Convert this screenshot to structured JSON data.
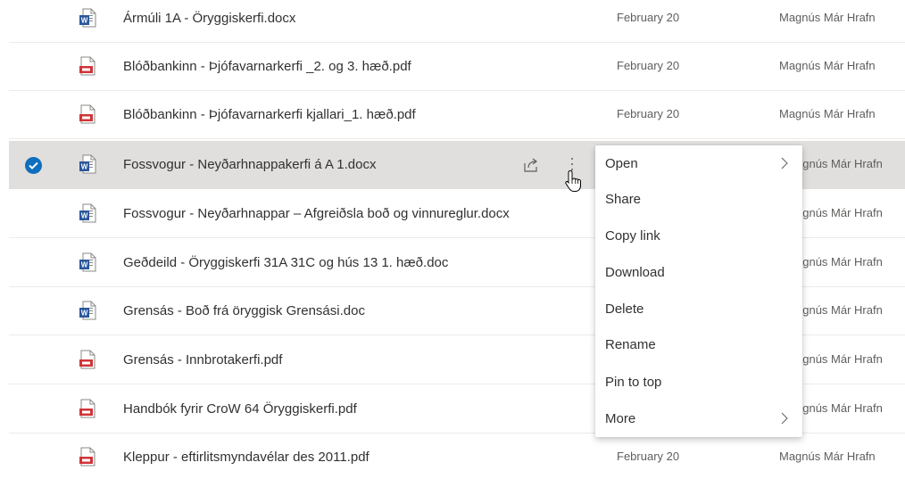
{
  "files": [
    {
      "name": "Ármúli 1A - Öryggiskerfi.docx",
      "type": "word",
      "date": "February 20",
      "modified_by": "Magnús Már Hrafn"
    },
    {
      "name": "Blóðbankinn - Þjófavarnarkerfi _2. og 3. hæð.pdf",
      "type": "pdf",
      "date": "February 20",
      "modified_by": "Magnús Már Hrafn"
    },
    {
      "name": "Blóðbankinn - Þjófavarnarkerfi kjallari_1. hæð.pdf",
      "type": "pdf",
      "date": "February 20",
      "modified_by": "Magnús Már Hrafn"
    },
    {
      "name": "Fossvogur - Neyðarhnappakerfi á A 1.docx",
      "type": "word",
      "date": "",
      "modified_by": "agnús Már Hrafn",
      "selected": true
    },
    {
      "name": "Fossvogur - Neyðarhnappar – Afgreiðsla boð og vinnureglur.docx",
      "type": "word",
      "date": "",
      "modified_by": "agnús Már Hrafn"
    },
    {
      "name": "Geðdeild - Öryggiskerfi 31A 31C og hús 13 1. hæð.doc",
      "type": "word",
      "date": "",
      "modified_by": "agnús Már Hrafn"
    },
    {
      "name": "Grensás - Boð frá öryggisk Grensási.doc",
      "type": "word",
      "date": "",
      "modified_by": "agnús Már Hrafn"
    },
    {
      "name": "Grensás - Innbrotakerfi.pdf",
      "type": "pdf",
      "date": "",
      "modified_by": "agnús Már Hrafn"
    },
    {
      "name": "Handbók fyrir CroW 64 Öryggiskerfi.pdf",
      "type": "pdf",
      "date": "",
      "modified_by": "agnús Már Hrafn"
    },
    {
      "name": "Kleppur - eftirlitsmyndavélar des 2011.pdf",
      "type": "pdf",
      "date": "February 20",
      "modified_by": "Magnús Már Hrafn"
    }
  ],
  "context_menu": {
    "items": [
      {
        "label": "Open",
        "submenu": true
      },
      {
        "label": "Share",
        "submenu": false
      },
      {
        "label": "Copy link",
        "submenu": false
      },
      {
        "label": "Download",
        "submenu": false
      },
      {
        "label": "Delete",
        "submenu": false
      },
      {
        "label": "Rename",
        "submenu": false
      },
      {
        "label": "Pin to top",
        "submenu": false
      },
      {
        "label": "More",
        "submenu": true
      }
    ]
  },
  "colors": {
    "selected_row": "#e1dfdd",
    "check_circle": "#106ebe",
    "word_blue": "#2b579a",
    "pdf_red": "#d13438"
  },
  "icons": {
    "word": "word-document-icon",
    "pdf": "pdf-document-icon",
    "check": "checkmark-circle-icon",
    "share": "share-icon",
    "more": "more-vertical-icon",
    "chevron": "chevron-right-icon"
  }
}
